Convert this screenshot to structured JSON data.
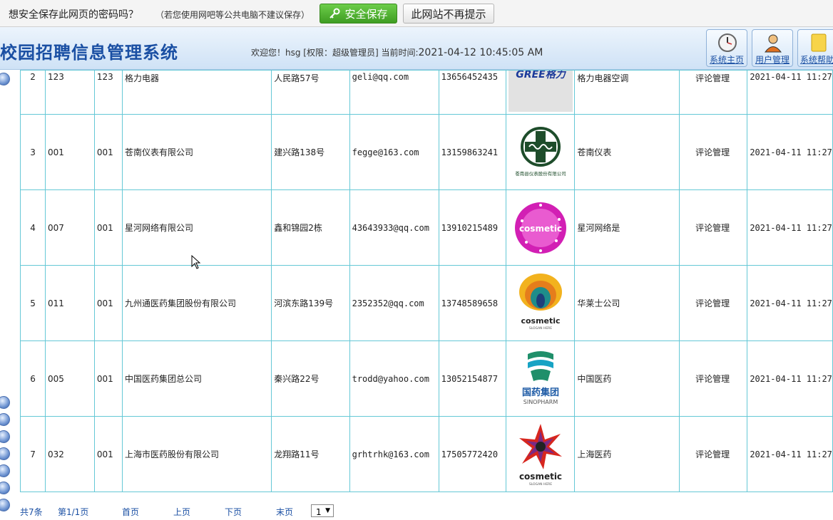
{
  "password_bar": {
    "question": "想安全保存此网页的密码吗？",
    "hint": "（若您使用网吧等公共电脑不建议保存）",
    "save_label": "安全保存",
    "never_label": "此网站不再提示",
    "save_icon": "key-icon"
  },
  "header": {
    "title": "校园招聘信息管理系统",
    "welcome": "欢迎您！hsg [权限：超级管理员] 当前时间:",
    "time": "2021-04-12 10:45:05 AM",
    "buttons": [
      {
        "label": "系统主页",
        "icon": "clock-icon"
      },
      {
        "label": "用户管理",
        "icon": "user-icon"
      },
      {
        "label": "系统帮助",
        "icon": "help-icon"
      }
    ]
  },
  "table": {
    "rows": [
      {
        "idx": "2",
        "code": "123",
        "code2": "123",
        "company": "格力电器",
        "address": "人民路57号",
        "email": "geli@qq.com",
        "phone": "13656452435",
        "logo": "gree-logo",
        "short": "格力电器空调",
        "action": "评论管理",
        "time": "2021-04-11 11:27"
      },
      {
        "idx": "3",
        "code": "001",
        "code2": "001",
        "company": "苍南仪表有限公司",
        "address": "建兴路138号",
        "email": "fegge@163.com",
        "phone": "13159863241",
        "logo": "meter-logo",
        "short": "苍南仪表",
        "action": "评论管理",
        "time": "2021-04-11 11:27"
      },
      {
        "idx": "4",
        "code": "007",
        "code2": "001",
        "company": "星河网络有限公司",
        "address": "鑫和锦园2栋",
        "email": "43643933@qq.com",
        "phone": "13910215489",
        "logo": "cosmetic-star-logo",
        "short": "星河网络是",
        "action": "评论管理",
        "time": "2021-04-11 11:27"
      },
      {
        "idx": "5",
        "code": "011",
        "code2": "001",
        "company": "九州通医药集团股份有限公司",
        "address": "河滨东路139号",
        "email": "2352352@qq.com",
        "phone": "13748589658",
        "logo": "cosmetic-peacock-logo",
        "short": "华莱士公司",
        "action": "评论管理",
        "time": "2021-04-11 11:27"
      },
      {
        "idx": "6",
        "code": "005",
        "code2": "001",
        "company": "中国医药集团总公司",
        "address": "秦兴路22号",
        "email": "trodd@yahoo.com",
        "phone": "13052154877",
        "logo": "sinopharm-logo",
        "short": "中国医药",
        "action": "评论管理",
        "time": "2021-04-11 11:27"
      },
      {
        "idx": "7",
        "code": "032",
        "code2": "001",
        "company": "上海市医药股份有限公司",
        "address": "龙翔路11号",
        "email": "grhtrhk@163.com",
        "phone": "17505772420",
        "logo": "cosmetic-burst-logo",
        "short": "上海医药",
        "action": "评论管理",
        "time": "2021-04-11 11:27"
      }
    ],
    "logo_text": {
      "gree": "GREE格力",
      "meter_caption": "苍南县仪表股份有限公司",
      "cosmetic": "cosmetic",
      "slogan": "SLOGAN HERE",
      "sinopharm_cn": "国药集团",
      "sinopharm_en": "SINOPHARM"
    }
  },
  "pager": {
    "total": "共7条",
    "page": "第1/1页",
    "first": "首页",
    "prev": "上页",
    "next": "下页",
    "last": "末页",
    "select_value": "1"
  }
}
